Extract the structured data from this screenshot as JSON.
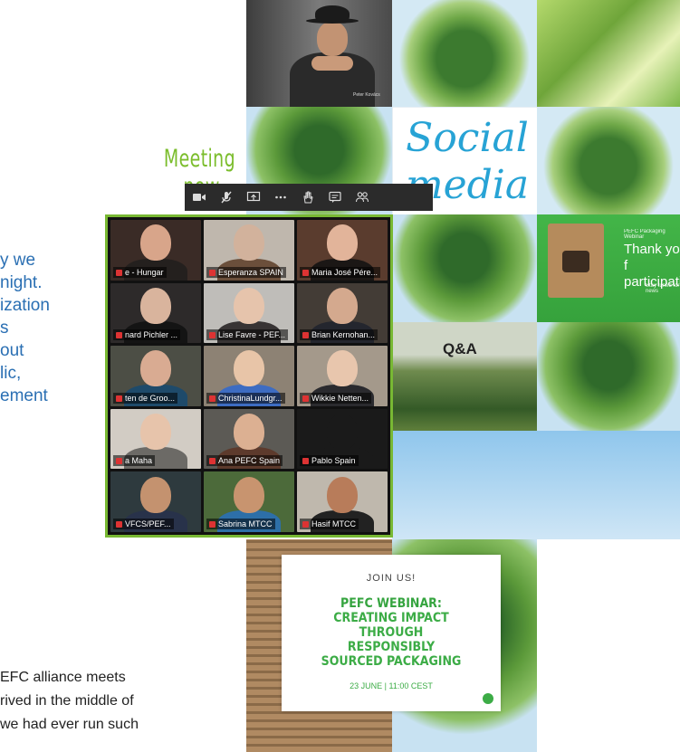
{
  "heading": "Meeting now...",
  "intro_lines": [
    "y we",
    "night.",
    "ization",
    "s",
    "out",
    "lic,",
    "ement"
  ],
  "bottom_lines": [
    "EFC alliance meets",
    "rived in the middle of",
    "we had ever run such"
  ],
  "toolbar": {
    "buttons": [
      {
        "name": "camera",
        "icon": "video-camera-icon"
      },
      {
        "name": "mute",
        "icon": "mic-off-icon"
      },
      {
        "name": "share",
        "icon": "share-screen-icon"
      },
      {
        "name": "more",
        "icon": "more-icon"
      },
      {
        "name": "raise-hand",
        "icon": "raise-hand-icon"
      },
      {
        "name": "chat",
        "icon": "chat-icon"
      },
      {
        "name": "participants",
        "icon": "participants-icon"
      }
    ]
  },
  "participants": [
    {
      "name": "e - Hungar",
      "bg": "#3a2b26",
      "face": "#d8a58a",
      "body": "#24201e"
    },
    {
      "name": "Esperanza SPAIN",
      "bg": "#bfb7ad",
      "face": "#d2b29c",
      "body": "#6b4f3b"
    },
    {
      "name": "Maria José Pére...",
      "bg": "#5a3c2e",
      "face": "#e2b49a",
      "body": "#1b1715"
    },
    {
      "name": "nard Pichler ...",
      "bg": "#2d2a2a",
      "face": "#d9b49d",
      "body": "#141414"
    },
    {
      "name": "Lise Favre - PEF...",
      "bg": "#bfbdb9",
      "face": "#e6c4ac",
      "body": "#383434"
    },
    {
      "name": "Brian Kernohan...",
      "bg": "#433c36",
      "face": "#d4a98e",
      "body": "#24262e"
    },
    {
      "name": "ten de Groo...",
      "bg": "#4c4e45",
      "face": "#d9ab92",
      "body": "#1e4a6a"
    },
    {
      "name": "ChristinaLundgr...",
      "bg": "#8d8274",
      "face": "#e8c5a8",
      "body": "#3d6cc2"
    },
    {
      "name": "Wikkie Netten...",
      "bg": "#a4998b",
      "face": "#e8c6ad",
      "body": "#2a2a2e"
    },
    {
      "name": "a Maha",
      "bg": "#d2ccc4",
      "face": "#e7c4ab",
      "body": "#6c6a66"
    },
    {
      "name": "Ana PEFC Spain",
      "bg": "#5c5a55",
      "face": "#dcb092",
      "body": "#5d3a2c"
    },
    {
      "name": "Pablo Spain",
      "bg": "#1a1a1a",
      "face": "#1a1a1a",
      "body": "#1a1a1a"
    },
    {
      "name": "VFCS/PEF...",
      "bg": "#2e3a3e",
      "face": "#c4926f",
      "body": "#28324a"
    },
    {
      "name": "Sabrina MTCC",
      "bg": "#4c6a3a",
      "face": "#c8946f",
      "body": "#2d6fa8"
    },
    {
      "name": "Hasif MTCC",
      "bg": "#bfb8ad",
      "face": "#b87c5a",
      "body": "#222222"
    }
  ],
  "collage": {
    "social_word_1": "Social",
    "social_word_2": "media",
    "qa_label": "Q&A",
    "thankyou_small": "PEFC Packaging Webinar",
    "thankyou_line1": "Thank you f",
    "thankyou_line2": "participatin",
    "thankyou_note": "Stay tuned for news",
    "presenter_name": "Peter Kovács"
  },
  "webinar": {
    "join": "JOIN US!",
    "title_lines": [
      "PEFC WEBINAR:",
      "CREATING IMPACT",
      "THROUGH",
      "RESPONSIBLY",
      "SOURCED PACKAGING"
    ],
    "date": "23 JUNE | 11:00 CEST"
  },
  "colors": {
    "accent_green": "#7bbd2c",
    "text_blue": "#2a6fb3",
    "toolbar_bg": "#2b2b2b"
  }
}
